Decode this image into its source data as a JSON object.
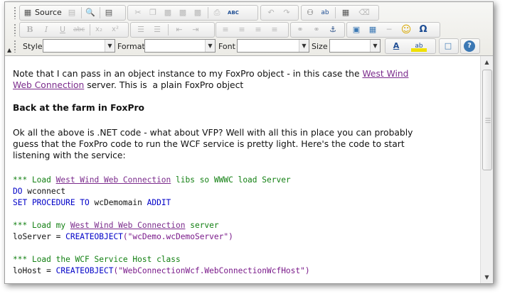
{
  "toolbar": {
    "source_label": "Source",
    "style_label": "Style",
    "format_label": "Format",
    "font_label": "Font",
    "size_label": "Size",
    "bold_glyph": "B",
    "italic_glyph": "I",
    "underline_glyph": "U",
    "strike_glyph": "abc",
    "subscript_glyph": "x₂",
    "superscript_glyph": "x²",
    "omega_glyph": "Ω",
    "smiley_glyph": "☺",
    "spell_glyph": "ABC",
    "find_glyph": "⚇",
    "replace_glyph": "ab",
    "style_value": "",
    "format_value": "",
    "font_value": "",
    "size_value": "",
    "text_color_glyph": "A",
    "bg_color_glyph": "ab",
    "help_glyph": "?"
  },
  "content": {
    "para1_line1_pre": "Note that I can pass in an object instance to my FoxPro object - in this case the ",
    "para1_link1": "West Wind",
    "para1_link2": "Web Connection",
    "para1_line2_post": " server. This is  a plain FoxPro object",
    "heading": "Back at the farm in FoxPro",
    "para2_line1": "Ok all the above is .NET code - what about VFP? Well with all this in place you can probably",
    "para2_line2": "guess that the FoxPro code to run the WCF service is pretty light. Here's the code to start",
    "para2_line3": "listening with the service:",
    "code1_pre": "*** Load ",
    "code1_link": "West Wind Web Connection",
    "code1_post": " libs so WWWC load Server",
    "code2_kw": "DO",
    "code2_txt": " wconnect",
    "code3_kw": "SET PROCEDURE TO",
    "code3_txt": " wcDemomain ",
    "code3_kw2": "ADDIT",
    "code4_pre": "*** Load my ",
    "code4_link": "West Wind Web Connection",
    "code4_post": " server",
    "code5_txt": "loServer = ",
    "code5_kw": "CREATEOBJECT",
    "code5_str": "(\"wcDemo.wcDemoServer\")",
    "code6": "*** Load the WCF Service Host class",
    "code7_txt": "loHost = ",
    "code7_kw": "CREATEOBJECT",
    "code7_str": "(\"WebConnectionWcf.WebConnectionWcfHost\")"
  },
  "colors": {
    "link": "#7b2b8c",
    "comment": "#138013",
    "keyword": "#0000c8"
  }
}
